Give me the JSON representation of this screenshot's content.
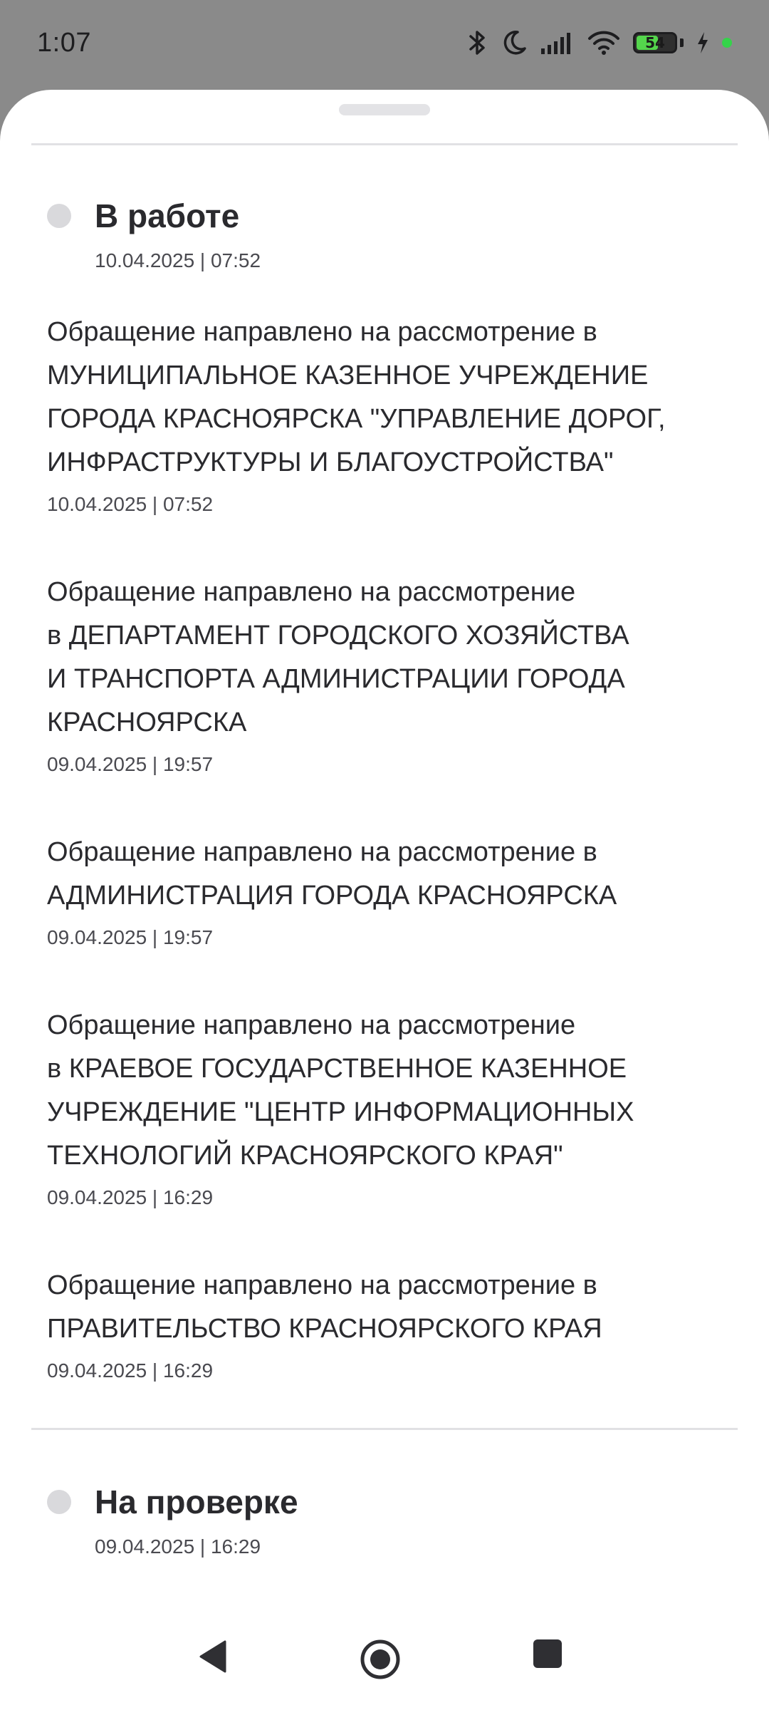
{
  "status_bar": {
    "time": "1:07",
    "battery_level": "54",
    "icons": [
      "bluetooth-icon",
      "moon-icon",
      "signal-icon",
      "wifi-icon",
      "battery-icon",
      "charging-icon",
      "green-dot-indicator"
    ]
  },
  "sections": [
    {
      "title": "В работе",
      "date": "10.04.2025 | 07:52",
      "events": [
        {
          "lines": [
            "Обращение направлено на рассмотрение в",
            "МУНИЦИПАЛЬНОЕ КАЗЕННОЕ УЧРЕЖДЕНИЕ",
            "ГОРОДА КРАСНОЯРСКА \"УПРАВЛЕНИЕ ДОРОГ,",
            "ИНФРАСТРУКТУРЫ И БЛАГОУСТРОЙСТВА\""
          ],
          "date": "10.04.2025 | 07:52"
        },
        {
          "lines": [
            "Обращение направлено на рассмотрение",
            "в ДЕПАРТАМЕНТ ГОРОДСКОГО ХОЗЯЙСТВА",
            "И ТРАНСПОРТА АДМИНИСТРАЦИИ ГОРОДА",
            "КРАСНОЯРСКА"
          ],
          "date": "09.04.2025 | 19:57"
        },
        {
          "lines": [
            "Обращение направлено на рассмотрение в",
            "АДМИНИСТРАЦИЯ ГОРОДА КРАСНОЯРСКА"
          ],
          "date": "09.04.2025 | 19:57"
        },
        {
          "lines": [
            "Обращение направлено на рассмотрение",
            "в КРАЕВОЕ ГОСУДАРСТВЕННОЕ КАЗЕННОЕ",
            "УЧРЕЖДЕНИЕ \"ЦЕНТР ИНФОРМАЦИОННЫХ",
            "ТЕХНОЛОГИЙ КРАСНОЯРСКОГО КРАЯ\""
          ],
          "date": "09.04.2025 | 16:29"
        },
        {
          "lines": [
            "Обращение направлено на рассмотрение в",
            "ПРАВИТЕЛЬСТВО КРАСНОЯРСКОГО КРАЯ"
          ],
          "date": "09.04.2025 | 16:29"
        }
      ]
    },
    {
      "title": "На проверке",
      "date": "09.04.2025 | 16:29",
      "events": []
    }
  ],
  "nav_bar": {
    "buttons": [
      "back-icon",
      "home-icon",
      "recents-icon"
    ]
  },
  "colors": {
    "scrim": "#8a8a8a",
    "sheet": "#ffffff",
    "status_dot": "#d9d9dc",
    "divider": "#e1e1e4",
    "text_primary": "#2a2a2e",
    "text_secondary": "#4a4a50"
  }
}
